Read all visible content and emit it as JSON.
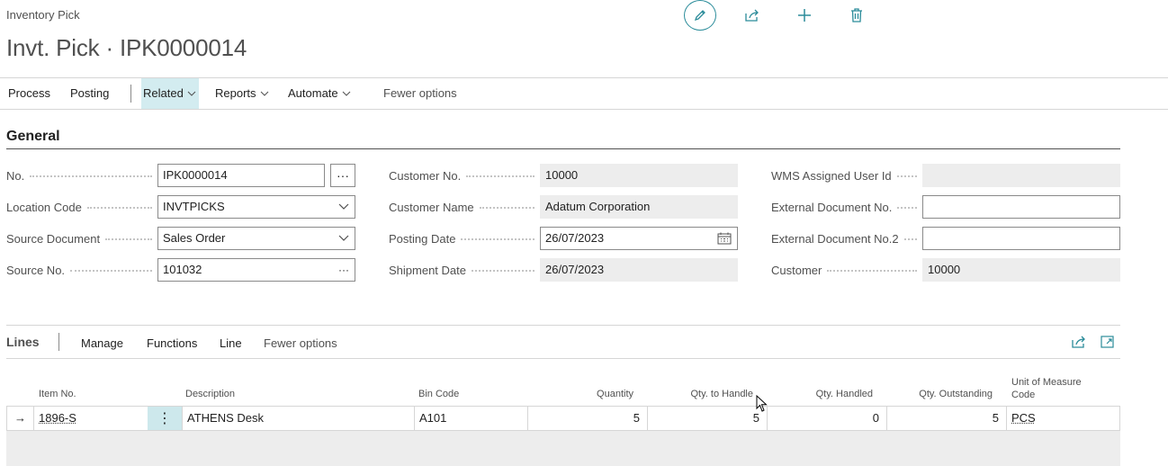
{
  "breadcrumb": "Inventory Pick",
  "title": "Invt. Pick · IPK0000014",
  "top_actions": {
    "edit": "edit-icon",
    "share": "share-icon",
    "new": "plus-icon",
    "delete": "trash-icon"
  },
  "action_bar": {
    "process": "Process",
    "posting": "Posting",
    "related": "Related",
    "reports": "Reports",
    "automate": "Automate",
    "fewer": "Fewer options"
  },
  "general": {
    "title": "General",
    "fields": {
      "no": {
        "label": "No.",
        "value": "IPK0000014"
      },
      "location_code": {
        "label": "Location Code",
        "value": "INVTPICKS"
      },
      "source_document": {
        "label": "Source Document",
        "value": "Sales Order"
      },
      "source_no": {
        "label": "Source No.",
        "value": "101032"
      },
      "customer_no": {
        "label": "Customer No.",
        "value": "10000"
      },
      "customer_name": {
        "label": "Customer Name",
        "value": "Adatum Corporation"
      },
      "posting_date": {
        "label": "Posting Date",
        "value": "26/07/2023"
      },
      "shipment_date": {
        "label": "Shipment Date",
        "value": "26/07/2023"
      },
      "wms_user": {
        "label": "WMS Assigned User Id",
        "value": ""
      },
      "ext_doc_no": {
        "label": "External Document No.",
        "value": ""
      },
      "ext_doc_no2": {
        "label": "External Document No.2",
        "value": ""
      },
      "customer": {
        "label": "Customer",
        "value": "10000"
      }
    },
    "assist_glyph": "···",
    "ellipsis_glyph": "···"
  },
  "lines": {
    "title": "Lines",
    "menu": {
      "manage": "Manage",
      "functions": "Functions",
      "line": "Line",
      "fewer": "Fewer options"
    },
    "columns": {
      "item_no": "Item No.",
      "description": "Description",
      "bin_code": "Bin Code",
      "quantity": "Quantity",
      "qty_to_handle": "Qty. to Handle",
      "qty_handled": "Qty. Handled",
      "qty_outstanding": "Qty. Outstanding",
      "uom_line1": "Unit of Measure",
      "uom_line2": "Code"
    },
    "rows": [
      {
        "arrow": "→",
        "item_no": "1896-S",
        "row_menu": "⋮",
        "description": "ATHENS Desk",
        "bin_code": "A101",
        "quantity": "5",
        "qty_to_handle": "5",
        "qty_handled": "0",
        "qty_outstanding": "5",
        "uom": "PCS"
      }
    ]
  },
  "colors": {
    "accent": "#2b8c9a",
    "active_bg": "#d3ecf0",
    "readonly_bg": "#ededed"
  }
}
